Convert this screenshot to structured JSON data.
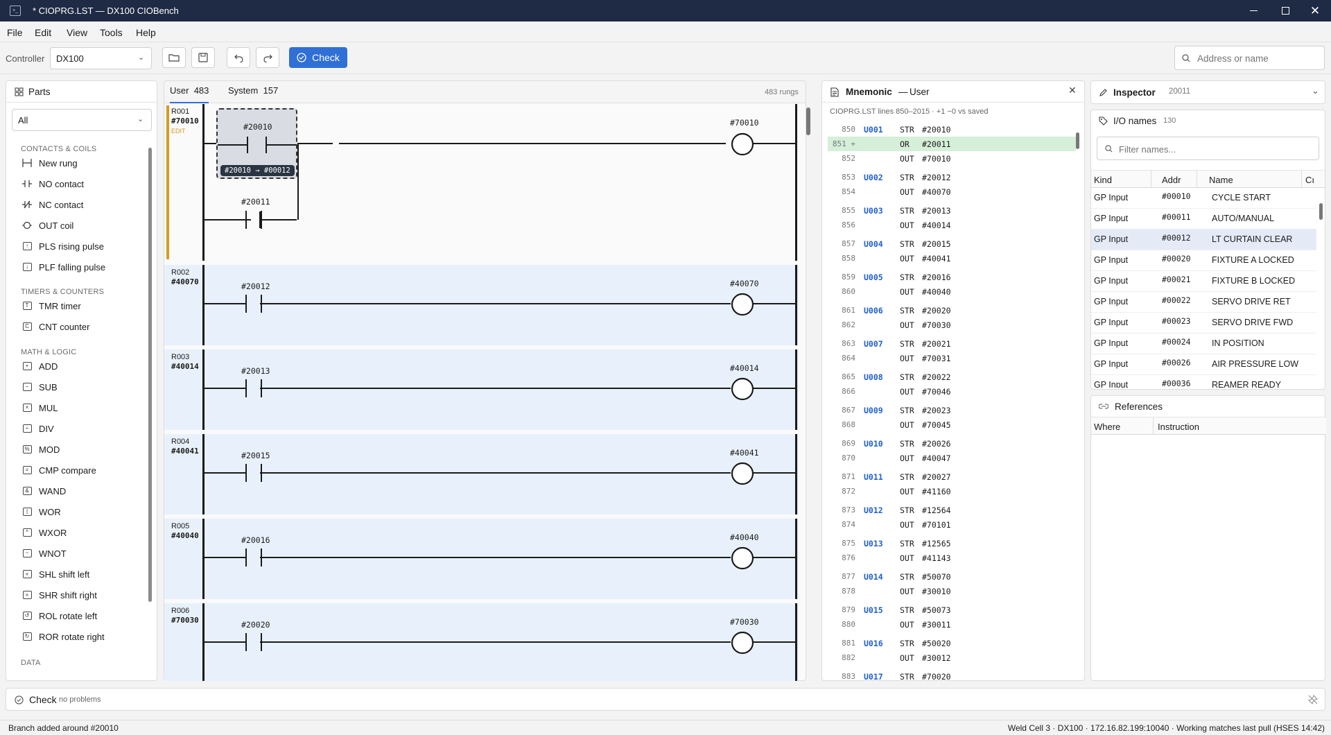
{
  "window": {
    "title": "* CIOPRG.LST — DX100 CIOBench"
  },
  "menu": [
    "File",
    "Edit",
    "View",
    "Tools",
    "Help"
  ],
  "toolbar": {
    "controller_label": "Controller",
    "controller_value": "DX100",
    "check_label": "Check",
    "search_placeholder": "Address or name"
  },
  "parts": {
    "title": "Parts",
    "filter": "All",
    "categories": [
      {
        "name": "CONTACTS & COILS",
        "items": [
          {
            "label": "New rung",
            "icon": "new-rung-icon"
          },
          {
            "label": "NO contact",
            "icon": "no-contact-icon"
          },
          {
            "label": "NC contact",
            "icon": "nc-contact-icon"
          },
          {
            "label": "OUT coil",
            "icon": "out-coil-icon"
          },
          {
            "label": "PLS rising pulse",
            "icon": "pls-icon"
          },
          {
            "label": "PLF falling pulse",
            "icon": "plf-icon"
          }
        ]
      },
      {
        "name": "TIMERS & COUNTERS",
        "items": [
          {
            "label": "TMR timer",
            "icon": "timer-icon"
          },
          {
            "label": "CNT counter",
            "icon": "counter-icon"
          }
        ]
      },
      {
        "name": "MATH & LOGIC",
        "items": [
          {
            "label": "ADD",
            "icon": "add-icon"
          },
          {
            "label": "SUB",
            "icon": "sub-icon"
          },
          {
            "label": "MUL",
            "icon": "mul-icon"
          },
          {
            "label": "DIV",
            "icon": "div-icon"
          },
          {
            "label": "MOD",
            "icon": "mod-icon"
          },
          {
            "label": "CMP compare",
            "icon": "cmp-icon"
          },
          {
            "label": "WAND",
            "icon": "wand-icon"
          },
          {
            "label": "WOR",
            "icon": "wor-icon"
          },
          {
            "label": "WXOR",
            "icon": "wxor-icon"
          },
          {
            "label": "WNOT",
            "icon": "wnot-icon"
          },
          {
            "label": "SHL shift left",
            "icon": "shl-icon"
          },
          {
            "label": "SHR shift right",
            "icon": "shr-icon"
          },
          {
            "label": "ROL rotate left",
            "icon": "rol-icon"
          },
          {
            "label": "ROR rotate right",
            "icon": "ror-icon"
          }
        ]
      },
      {
        "name": "DATA",
        "items": []
      }
    ]
  },
  "ladder": {
    "tabs": [
      {
        "label": "User",
        "count": "483"
      },
      {
        "label": "System",
        "count": "157"
      }
    ],
    "rung_count": "483 rungs",
    "rungs": [
      {
        "id": "R001",
        "out": "#70010",
        "edit": "EDIT",
        "contact": "#20010",
        "branch_contact": "#20011",
        "coil": "#70010",
        "tooltip": "#20010 → #00012"
      },
      {
        "id": "R002",
        "out": "#40070",
        "contact": "#20012",
        "coil": "#40070"
      },
      {
        "id": "R003",
        "out": "#40014",
        "contact": "#20013",
        "coil": "#40014"
      },
      {
        "id": "R004",
        "out": "#40041",
        "contact": "#20015",
        "coil": "#40041"
      },
      {
        "id": "R005",
        "out": "#40040",
        "contact": "#20016",
        "coil": "#40040"
      },
      {
        "id": "R006",
        "out": "#70030",
        "contact": "#20020",
        "coil": "#70030"
      }
    ]
  },
  "mnemonic": {
    "title": "Mnemonic",
    "scope": "User",
    "subtitle": "CIOPRG.LST lines 850–2015  ·  +1 −0 vs saved",
    "lines": [
      {
        "n": "850",
        "tag": "U001",
        "op": "STR",
        "arg": "#20010"
      },
      {
        "n": "851 +",
        "tag": "",
        "op": "OR",
        "arg": "#20011",
        "added": true
      },
      {
        "n": "852",
        "tag": "",
        "op": "OUT",
        "arg": "#70010"
      },
      {
        "n": "853",
        "tag": "U002",
        "op": "STR",
        "arg": "#20012"
      },
      {
        "n": "854",
        "tag": "",
        "op": "OUT",
        "arg": "#40070"
      },
      {
        "n": "855",
        "tag": "U003",
        "op": "STR",
        "arg": "#20013"
      },
      {
        "n": "856",
        "tag": "",
        "op": "OUT",
        "arg": "#40014"
      },
      {
        "n": "857",
        "tag": "U004",
        "op": "STR",
        "arg": "#20015"
      },
      {
        "n": "858",
        "tag": "",
        "op": "OUT",
        "arg": "#40041"
      },
      {
        "n": "859",
        "tag": "U005",
        "op": "STR",
        "arg": "#20016"
      },
      {
        "n": "860",
        "tag": "",
        "op": "OUT",
        "arg": "#40040"
      },
      {
        "n": "861",
        "tag": "U006",
        "op": "STR",
        "arg": "#20020"
      },
      {
        "n": "862",
        "tag": "",
        "op": "OUT",
        "arg": "#70030"
      },
      {
        "n": "863",
        "tag": "U007",
        "op": "STR",
        "arg": "#20021"
      },
      {
        "n": "864",
        "tag": "",
        "op": "OUT",
        "arg": "#70031"
      },
      {
        "n": "865",
        "tag": "U008",
        "op": "STR",
        "arg": "#20022"
      },
      {
        "n": "866",
        "tag": "",
        "op": "OUT",
        "arg": "#70046"
      },
      {
        "n": "867",
        "tag": "U009",
        "op": "STR",
        "arg": "#20023"
      },
      {
        "n": "868",
        "tag": "",
        "op": "OUT",
        "arg": "#70045"
      },
      {
        "n": "869",
        "tag": "U010",
        "op": "STR",
        "arg": "#20026"
      },
      {
        "n": "870",
        "tag": "",
        "op": "OUT",
        "arg": "#40047"
      },
      {
        "n": "871",
        "tag": "U011",
        "op": "STR",
        "arg": "#20027"
      },
      {
        "n": "872",
        "tag": "",
        "op": "OUT",
        "arg": "#41160"
      },
      {
        "n": "873",
        "tag": "U012",
        "op": "STR",
        "arg": "#12564"
      },
      {
        "n": "874",
        "tag": "",
        "op": "OUT",
        "arg": "#70101"
      },
      {
        "n": "875",
        "tag": "U013",
        "op": "STR",
        "arg": "#12565"
      },
      {
        "n": "876",
        "tag": "",
        "op": "OUT",
        "arg": "#41143"
      },
      {
        "n": "877",
        "tag": "U014",
        "op": "STR",
        "arg": "#50070"
      },
      {
        "n": "878",
        "tag": "",
        "op": "OUT",
        "arg": "#30010"
      },
      {
        "n": "879",
        "tag": "U015",
        "op": "STR",
        "arg": "#50073"
      },
      {
        "n": "880",
        "tag": "",
        "op": "OUT",
        "arg": "#30011"
      },
      {
        "n": "881",
        "tag": "U016",
        "op": "STR",
        "arg": "#50020"
      },
      {
        "n": "882",
        "tag": "",
        "op": "OUT",
        "arg": "#30012"
      },
      {
        "n": "883",
        "tag": "U017",
        "op": "STR",
        "arg": "#70020"
      }
    ]
  },
  "inspector": {
    "title": "Inspector",
    "selected": "20011",
    "io_title": "I/O names",
    "io_count": "130",
    "filter_placeholder": "Filter names...",
    "columns": [
      "Kind",
      "Addr",
      "Name",
      "Cı"
    ],
    "rows": [
      {
        "kind": "GP Input",
        "addr": "#00010",
        "name": "CYCLE START"
      },
      {
        "kind": "GP Input",
        "addr": "#00011",
        "name": "AUTO/MANUAL"
      },
      {
        "kind": "GP Input",
        "addr": "#00012",
        "name": "LT CURTAIN CLEAR",
        "selected": true
      },
      {
        "kind": "GP Input",
        "addr": "#00020",
        "name": "FIXTURE A LOCKED"
      },
      {
        "kind": "GP Input",
        "addr": "#00021",
        "name": "FIXTURE B LOCKED"
      },
      {
        "kind": "GP Input",
        "addr": "#00022",
        "name": "SERVO DRIVE RET"
      },
      {
        "kind": "GP Input",
        "addr": "#00023",
        "name": "SERVO DRIVE FWD"
      },
      {
        "kind": "GP Input",
        "addr": "#00024",
        "name": "IN POSITION"
      },
      {
        "kind": "GP Input",
        "addr": "#00026",
        "name": "AIR PRESSURE LOW"
      },
      {
        "kind": "GP Input",
        "addr": "#00036",
        "name": "REAMER READY"
      }
    ],
    "ref_title": "References",
    "ref_columns": [
      "Where",
      "Instruction"
    ]
  },
  "check": {
    "label": "Check",
    "status": "no problems"
  },
  "status": {
    "left": "Branch added around #20010",
    "right": "Weld Cell 3 · DX100 · 172.16.82.199:10040 · Working matches last pull (HSES 14:42)"
  },
  "colors": {
    "accent": "#2f6fd6",
    "edit": "#d79b1f",
    "added_line": "#d5efd9",
    "rung_alt": "#e8f1fb",
    "titlebar": "#1f2a44",
    "tag": "#1f5fd1"
  }
}
